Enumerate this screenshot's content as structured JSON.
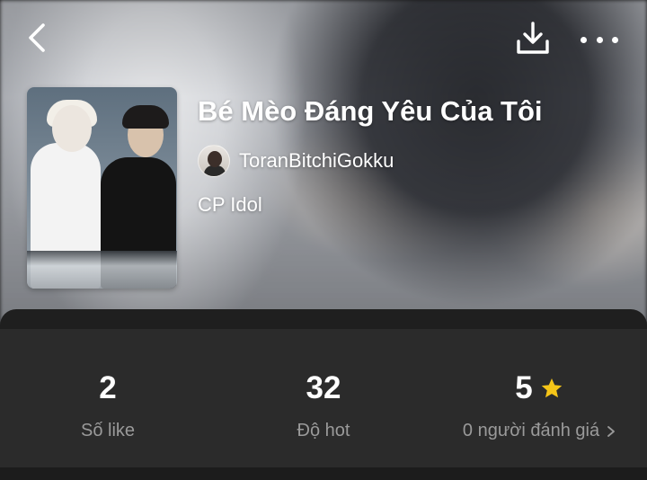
{
  "header": {
    "back_icon": "chevron-left-icon",
    "download_icon": "download-icon",
    "more_icon": "more-horizontal-icon"
  },
  "story": {
    "title": "Bé Mèo Đáng Yêu Của Tôi",
    "author": "ToranBitchiGokku",
    "category": "CP Idol"
  },
  "stats": [
    {
      "value": "2",
      "label": "Số like"
    },
    {
      "value": "32",
      "label": "Độ hot"
    },
    {
      "value": "5",
      "label": "0 người đánh giá",
      "icon": "star-icon",
      "trailing_icon": "chevron-right-icon"
    }
  ],
  "colors": {
    "background": "#1c1c1c",
    "stats_panel": "#2b2b2b",
    "label_gray": "#9a9a9a",
    "star": "#f5c518"
  }
}
